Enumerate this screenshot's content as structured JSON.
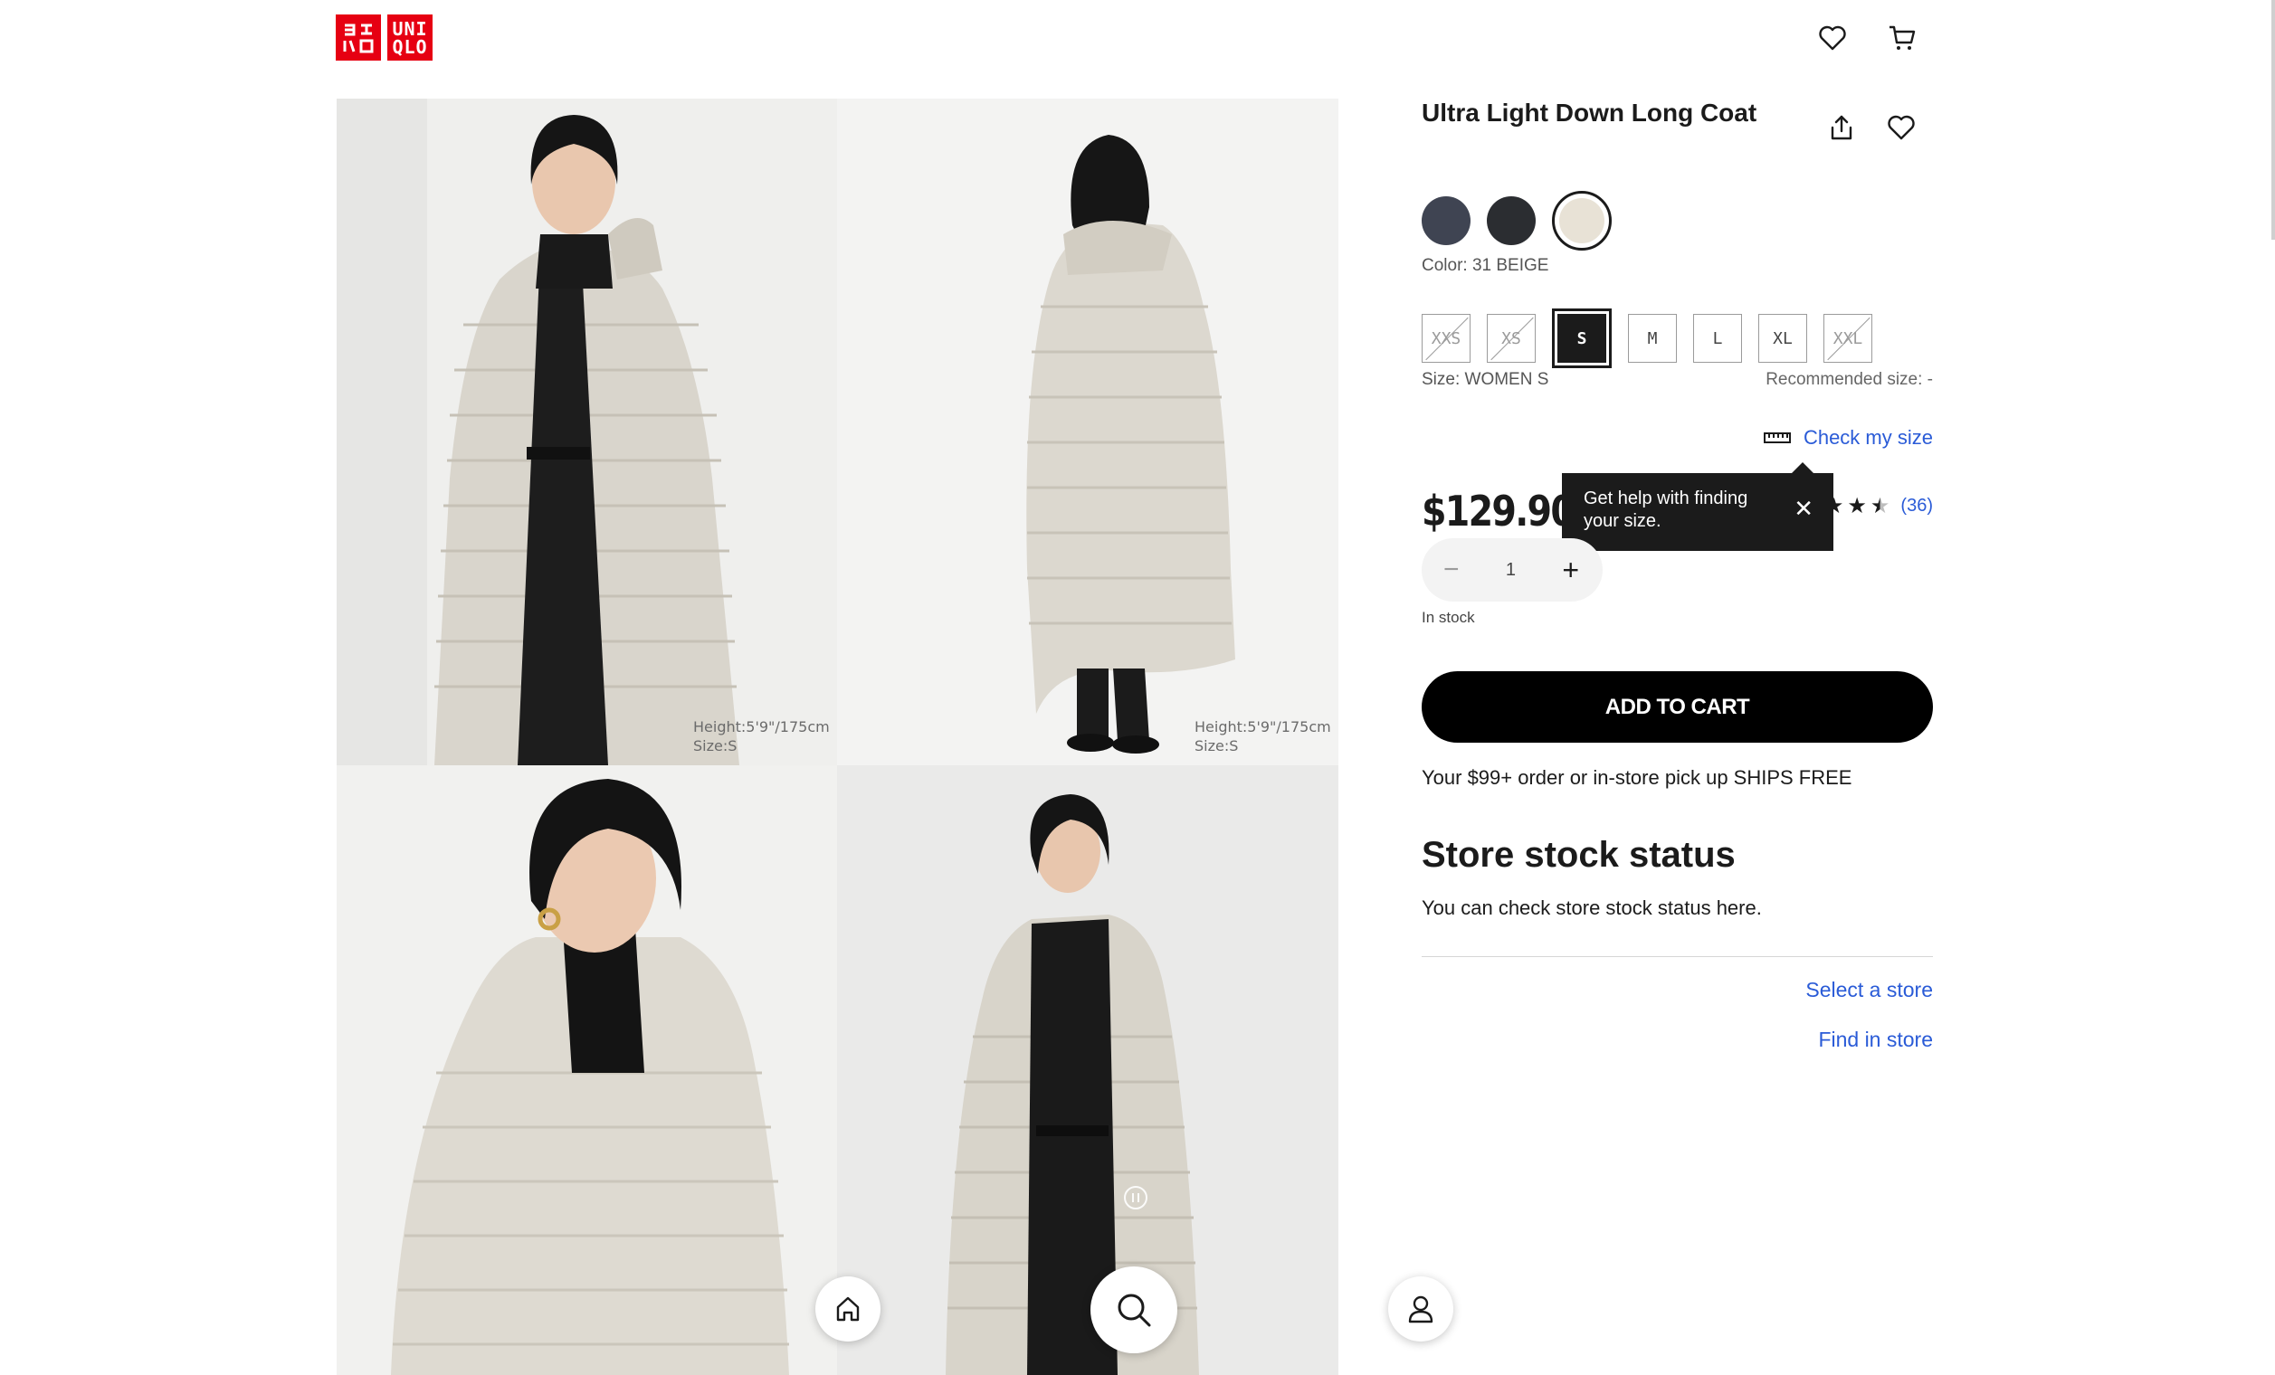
{
  "brand": {
    "logo_left": "ユニ クロ",
    "logo_right": "UNI QLO"
  },
  "header": {
    "wishlist_icon": "heart-icon",
    "cart_icon": "cart-icon"
  },
  "gallery": {
    "photos": [
      {
        "caption_1": "Height:5'9\"/175cm",
        "caption_2": "Size:S"
      },
      {
        "caption_1": "Height:5'9\"/175cm",
        "caption_2": "Size:S"
      },
      {
        "caption_1": "",
        "caption_2": ""
      },
      {
        "caption_1": "",
        "caption_2": ""
      }
    ]
  },
  "product": {
    "title": "Ultra Light Down Long Coat",
    "share_icon": "share-icon",
    "favorite_icon": "heart-icon",
    "colors": [
      {
        "name": "navy",
        "hex": "#3f4452"
      },
      {
        "name": "black",
        "hex": "#2b2d31"
      },
      {
        "name": "beige",
        "hex": "#e8e2d6",
        "selected": true
      }
    ],
    "color_label": "Color: 31 BEIGE",
    "sizes": [
      {
        "label": "XXS",
        "available": false
      },
      {
        "label": "XS",
        "available": false
      },
      {
        "label": "S",
        "available": true,
        "selected": true
      },
      {
        "label": "M",
        "available": true
      },
      {
        "label": "L",
        "available": true
      },
      {
        "label": "XL",
        "available": true
      },
      {
        "label": "XXL",
        "available": false
      }
    ],
    "size_label": "Size: WOMEN S",
    "recommended_size": "Recommended size: -",
    "check_size": "Check my size",
    "price": "$129.90",
    "rating_stars": 4.5,
    "review_count": "(36)",
    "tooltip": {
      "text": "Get help with finding your size.",
      "close": "✕"
    },
    "quantity": {
      "minus": "−",
      "value": "1",
      "plus": "+"
    },
    "stock_status": "In stock",
    "add_to_cart": "ADD TO CART",
    "shipping": "Your $99+ order or in-store pick up SHIPS FREE"
  },
  "store": {
    "heading": "Store stock status",
    "description": "You can check store stock status here.",
    "select_store": "Select a store",
    "find_in_store": "Find in store"
  },
  "bottom_nav": {
    "home_icon": "home-icon",
    "search_icon": "search-icon",
    "account_icon": "user-icon"
  },
  "colors": {
    "brand_red": "#e60012",
    "link_blue": "#2a5bd7",
    "dark": "#1b1b1b"
  }
}
